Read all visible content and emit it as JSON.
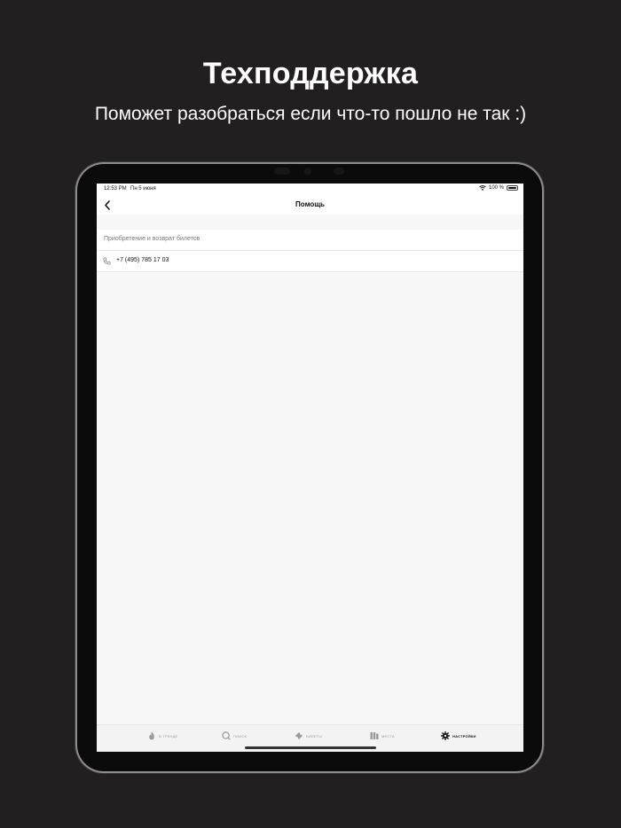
{
  "promo": {
    "title": "Техподдержка",
    "subtitle": "Поможет разобраться если что-то пошло не так :)"
  },
  "status_bar": {
    "time": "12:53 PM",
    "date": "Пн 5 июня",
    "battery": "100 %"
  },
  "nav": {
    "title": "Помощь",
    "back_icon": "chevron-left-icon"
  },
  "section": {
    "header": "Приобретение и возврат билетов",
    "rows": [
      {
        "icon": "phone-icon",
        "label": "+7 (495) 785 17 03"
      }
    ]
  },
  "tabbar": {
    "items": [
      {
        "icon": "flame-icon",
        "label": "в тренде",
        "active": false
      },
      {
        "icon": "search-icon",
        "label": "поиск",
        "active": false
      },
      {
        "icon": "ticket-icon",
        "label": "билеты",
        "active": false
      },
      {
        "icon": "places-icon",
        "label": "места",
        "active": false
      },
      {
        "icon": "gear-icon",
        "label": "настройки",
        "active": true
      }
    ]
  },
  "colors": {
    "page_background": "#221f20",
    "screen_background": "#f7f7f7",
    "active_tab": "#111111",
    "inactive_tab": "#9a9a9a"
  }
}
